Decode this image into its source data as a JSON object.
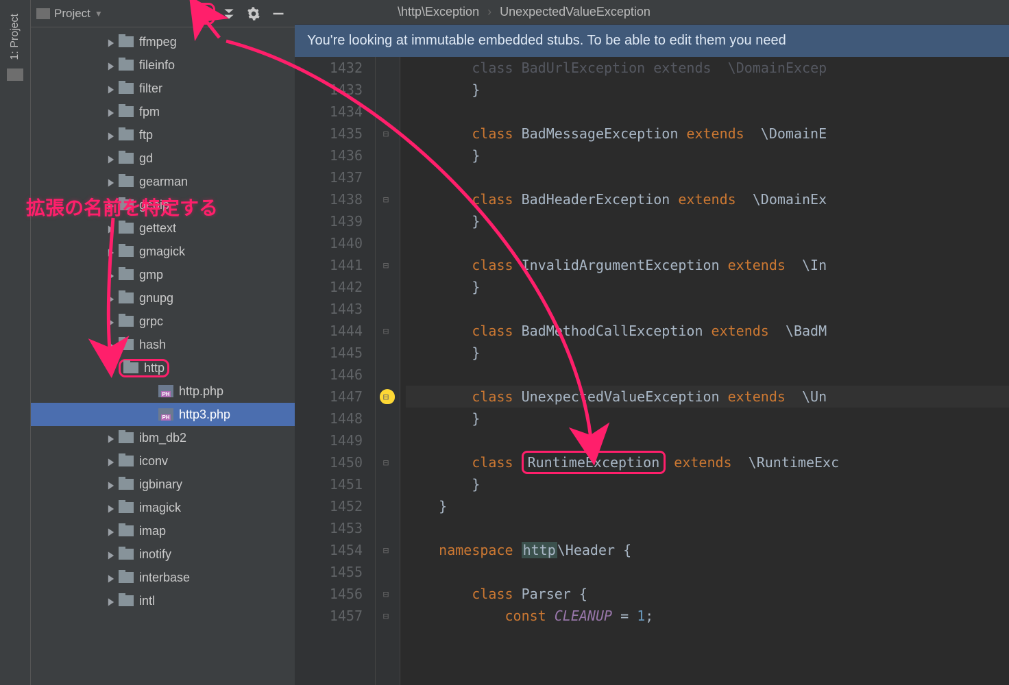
{
  "rail": {
    "label": "1: Project"
  },
  "project_header": {
    "title": "Project"
  },
  "tree": {
    "items": [
      {
        "name": "ffmpeg",
        "type": "folder",
        "indent": 110,
        "arrow": "right"
      },
      {
        "name": "fileinfo",
        "type": "folder",
        "indent": 110,
        "arrow": "right"
      },
      {
        "name": "filter",
        "type": "folder",
        "indent": 110,
        "arrow": "right"
      },
      {
        "name": "fpm",
        "type": "folder",
        "indent": 110,
        "arrow": "right"
      },
      {
        "name": "ftp",
        "type": "folder",
        "indent": 110,
        "arrow": "right"
      },
      {
        "name": "gd",
        "type": "folder",
        "indent": 110,
        "arrow": "right"
      },
      {
        "name": "gearman",
        "type": "folder",
        "indent": 110,
        "arrow": "right"
      },
      {
        "name": "geoip",
        "type": "folder",
        "indent": 110,
        "arrow": "right"
      },
      {
        "name": "gettext",
        "type": "folder",
        "indent": 110,
        "arrow": "right"
      },
      {
        "name": "gmagick",
        "type": "folder",
        "indent": 110,
        "arrow": "right"
      },
      {
        "name": "gmp",
        "type": "folder",
        "indent": 110,
        "arrow": "right"
      },
      {
        "name": "gnupg",
        "type": "folder",
        "indent": 110,
        "arrow": "right"
      },
      {
        "name": "grpc",
        "type": "folder",
        "indent": 110,
        "arrow": "right"
      },
      {
        "name": "hash",
        "type": "folder",
        "indent": 110,
        "arrow": "right"
      },
      {
        "name": "http",
        "type": "folder",
        "indent": 110,
        "arrow": "down",
        "boxed": true
      },
      {
        "name": "http.php",
        "type": "php",
        "indent": 168,
        "arrow": "none"
      },
      {
        "name": "http3.php",
        "type": "php",
        "indent": 168,
        "arrow": "none",
        "selected": true
      },
      {
        "name": "ibm_db2",
        "type": "folder",
        "indent": 110,
        "arrow": "right"
      },
      {
        "name": "iconv",
        "type": "folder",
        "indent": 110,
        "arrow": "right"
      },
      {
        "name": "igbinary",
        "type": "folder",
        "indent": 110,
        "arrow": "right"
      },
      {
        "name": "imagick",
        "type": "folder",
        "indent": 110,
        "arrow": "right"
      },
      {
        "name": "imap",
        "type": "folder",
        "indent": 110,
        "arrow": "right"
      },
      {
        "name": "inotify",
        "type": "folder",
        "indent": 110,
        "arrow": "right"
      },
      {
        "name": "interbase",
        "type": "folder",
        "indent": 110,
        "arrow": "right"
      },
      {
        "name": "intl",
        "type": "folder",
        "indent": 110,
        "arrow": "right"
      }
    ]
  },
  "breadcrumb": {
    "a": "\\http\\Exception",
    "b": "UnexpectedValueException"
  },
  "banner": "You're looking at immutable embedded stubs. To be able to edit them you need",
  "annotation": "拡張の名前を特定する",
  "code": {
    "first_line": 1432,
    "lines": [
      {
        "n": 1432,
        "html": "        <span class='dim kw'>class</span> <span class='dim'>BadUrlException</span> <span class='dim kw'>extends</span>  <span class='dim'>\\DomainExcep</span>"
      },
      {
        "n": 1433,
        "html": "        }"
      },
      {
        "n": 1434,
        "html": ""
      },
      {
        "n": 1435,
        "html": "        <span class='kw'>class</span> BadMessageException <span class='kw'>extends</span>  \\DomainE"
      },
      {
        "n": 1436,
        "html": "        }"
      },
      {
        "n": 1437,
        "html": ""
      },
      {
        "n": 1438,
        "html": "        <span class='kw'>class</span> BadHeaderException <span class='kw'>extends</span>  \\DomainEx"
      },
      {
        "n": 1439,
        "html": "        }"
      },
      {
        "n": 1440,
        "html": ""
      },
      {
        "n": 1441,
        "html": "        <span class='kw'>class</span> InvalidArgumentException <span class='kw'>extends</span>  \\In"
      },
      {
        "n": 1442,
        "html": "        }"
      },
      {
        "n": 1443,
        "html": ""
      },
      {
        "n": 1444,
        "html": "        <span class='kw'>class</span> BadMethodCallException <span class='kw'>extends</span>  \\BadM"
      },
      {
        "n": 1445,
        "html": "        }"
      },
      {
        "n": 1446,
        "html": ""
      },
      {
        "n": 1447,
        "html": "        <span class='kw'>class</span> UnexpectedValueException <span class='kw'>extends</span>  \\Un",
        "current": true,
        "bulb": true
      },
      {
        "n": 1448,
        "html": "        }"
      },
      {
        "n": 1449,
        "html": ""
      },
      {
        "n": 1450,
        "html": "        <span class='kw'>class</span> <span class='runtime-box'>RuntimeException</span> <span class='kw'>extends</span>  \\RuntimeExc"
      },
      {
        "n": 1451,
        "html": "        }"
      },
      {
        "n": 1452,
        "html": "    }"
      },
      {
        "n": 1453,
        "html": ""
      },
      {
        "n": 1454,
        "html": "    <span class='kw'>namespace</span> <span class='nsname'>http</span>\\Header {"
      },
      {
        "n": 1455,
        "html": ""
      },
      {
        "n": 1456,
        "html": "        <span class='kw'>class</span> Parser {"
      },
      {
        "n": 1457,
        "html": "            <span class='const-kw'>const</span> <span class='const-name'>CLEANUP</span> = <span class='num'>1</span>;"
      }
    ]
  }
}
